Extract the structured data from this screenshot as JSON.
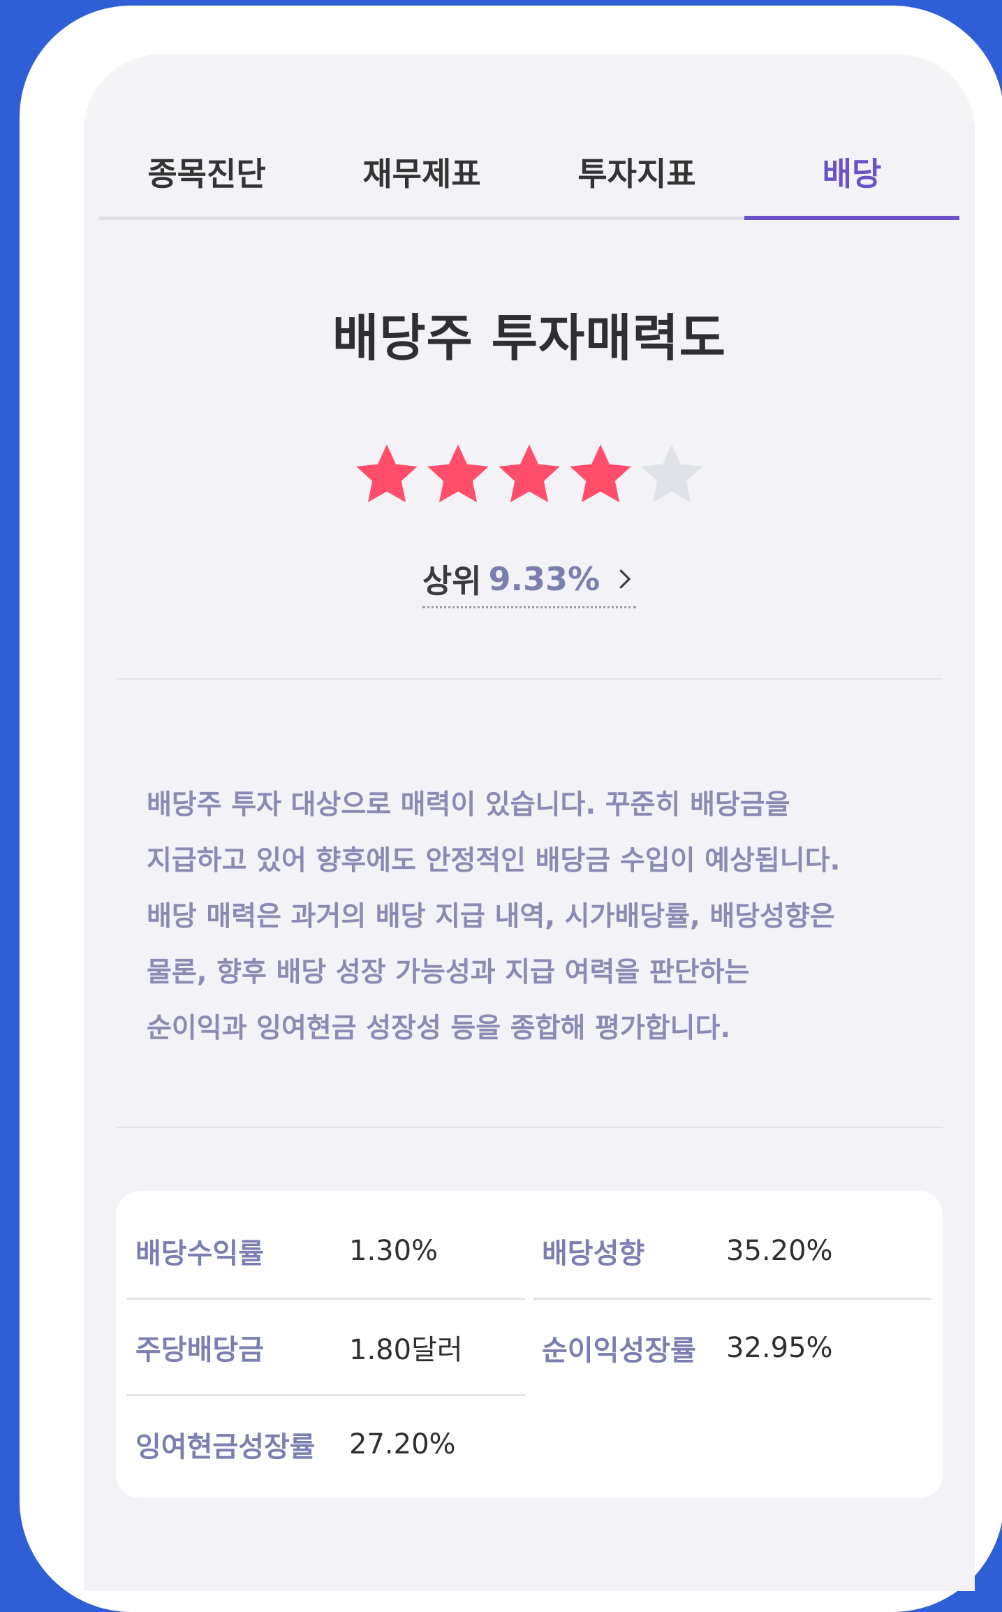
{
  "tabs": [
    {
      "label": "종목진단",
      "active": false
    },
    {
      "label": "재무제표",
      "active": false
    },
    {
      "label": "투자지표",
      "active": false
    },
    {
      "label": "배당",
      "active": true
    }
  ],
  "title": "배당주 투자매력도",
  "rating": {
    "value": 4,
    "max": 5,
    "filled_color": "#ff4d6a",
    "empty_color": "#dfe3e8"
  },
  "rank": {
    "prefix": "상위",
    "value": "9.33%",
    "icon": "chevron-right-icon"
  },
  "description": "배당주 투자 대상으로 매력이 있습니다. 꾸준히 배당금을\n지급하고 있어 향후에도 안정적인 배당금 수입이 예상됩니다.\n배당 매력은 과거의 배당 지급 내역, 시가배당률, 배당성향은\n물론, 향후 배당 성장 가능성과 지급 여력을 판단하는\n순이익과 잉여현금 성장성 등을 종합해 평가합니다.",
  "metrics": {
    "dividend_yield": {
      "label": "배당수익률",
      "value": "1.30%"
    },
    "payout_ratio": {
      "label": "배당성향",
      "value": "35.20%"
    },
    "dps": {
      "label": "주당배당금",
      "value": "1.80달러"
    },
    "net_income_growth": {
      "label": "순이익성장률",
      "value": "32.95%"
    },
    "fcf_growth": {
      "label": "잉여현금성장률",
      "value": "27.20%"
    }
  },
  "colors": {
    "accent": "#6a51c4",
    "label": "#7b7fb0",
    "background": "#2f5fd6"
  }
}
